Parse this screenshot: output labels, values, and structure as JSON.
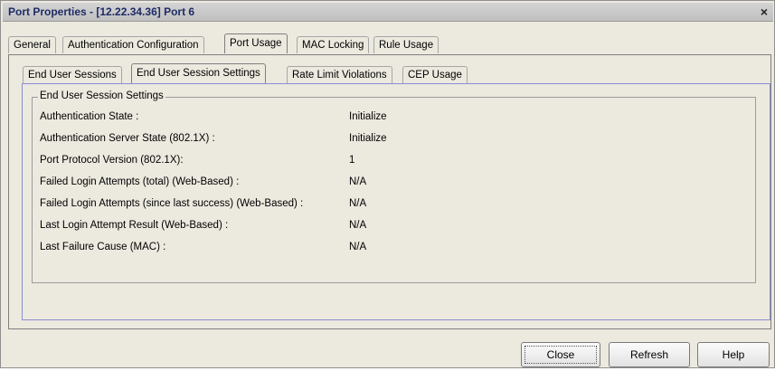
{
  "window": {
    "title": "Port Properties - [12.22.34.36] Port 6"
  },
  "tabs_outer": [
    "General",
    "Authentication Configuration",
    "Port Usage",
    "MAC Locking",
    "Rule Usage"
  ],
  "tabs_inner": [
    "End User Sessions",
    "End User Session Settings",
    "Rate Limit Violations",
    "CEP Usage"
  ],
  "group_title": "End User Session Settings",
  "fields": [
    {
      "label": "Authentication State :",
      "value": "Initialize"
    },
    {
      "label": "Authentication Server State (802.1X) :",
      "value": "Initialize"
    },
    {
      "label": "Port Protocol Version (802.1X):",
      "value": "1"
    },
    {
      "label": "Failed Login Attempts (total) (Web-Based) :",
      "value": "N/A"
    },
    {
      "label": "Failed Login Attempts (since last success) (Web-Based) :",
      "value": "N/A"
    },
    {
      "label": "Last Login Attempt Result (Web-Based) :",
      "value": "N/A"
    },
    {
      "label": "Last Failure Cause (MAC) :",
      "value": "N/A"
    }
  ],
  "buttons": {
    "close": "Close",
    "refresh": "Refresh",
    "help": "Help"
  },
  "close_glyph": "×"
}
